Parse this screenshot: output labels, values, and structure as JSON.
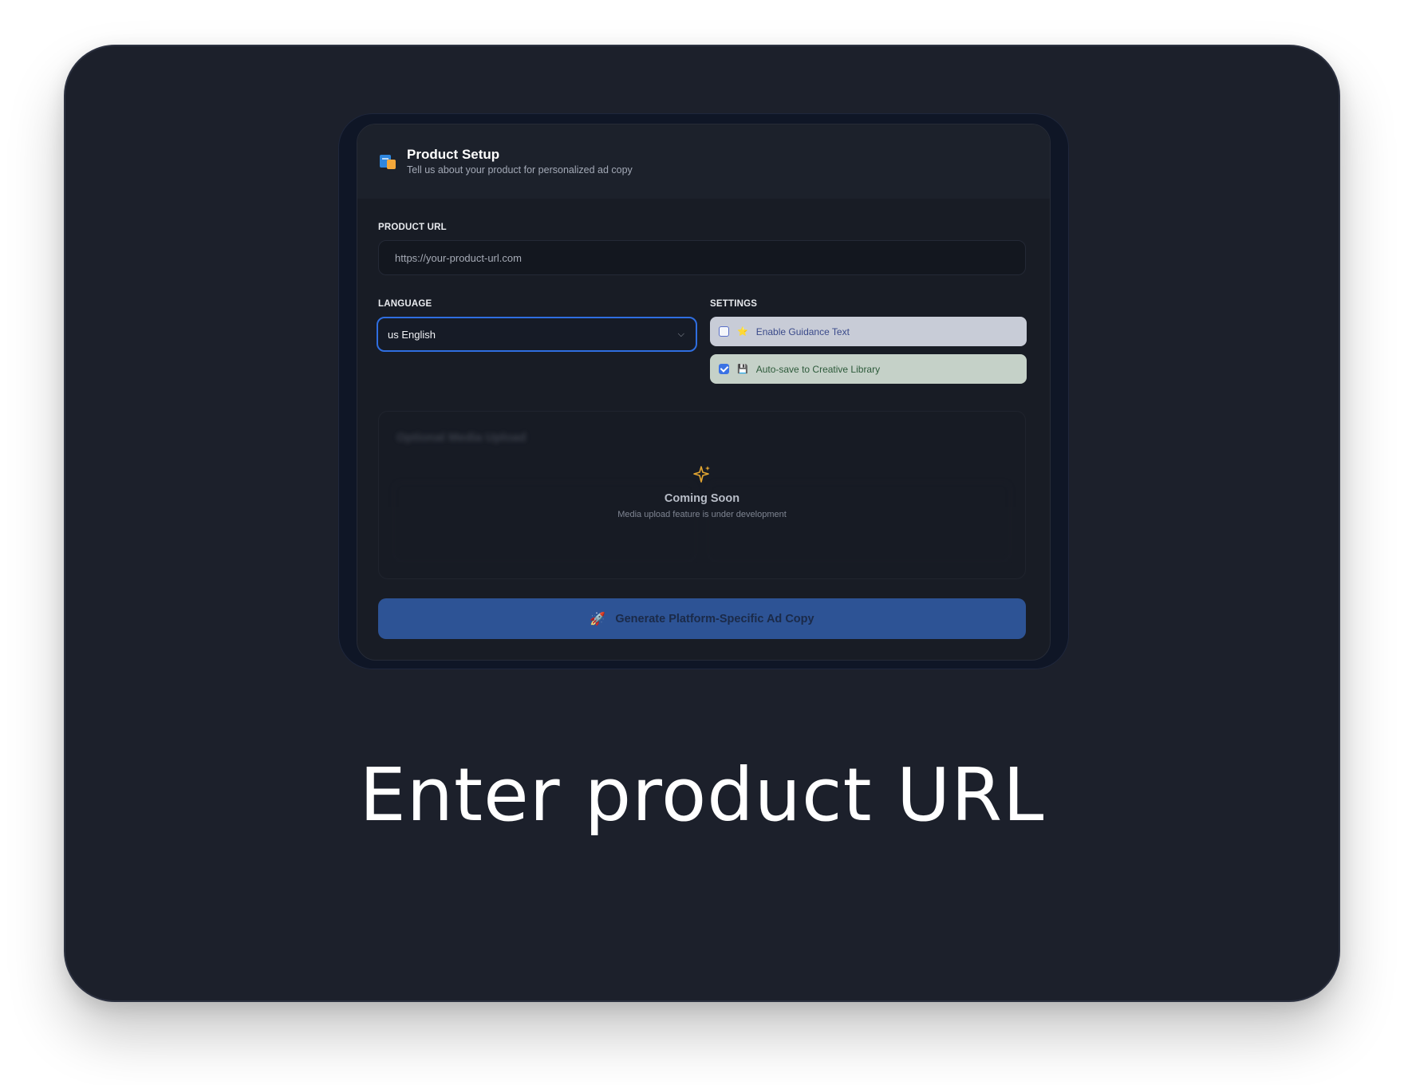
{
  "card": {
    "title": "Product Setup",
    "subtitle": "Tell us about your product for personalized ad copy"
  },
  "url_field": {
    "label": "PRODUCT URL",
    "placeholder": "https://your-product-url.com",
    "value": ""
  },
  "language": {
    "label": "LANGUAGE",
    "selected": "us English"
  },
  "settings": {
    "label": "SETTINGS",
    "guidance": {
      "emoji": "⭐",
      "label": "Enable Guidance Text",
      "checked": false
    },
    "autosave": {
      "emoji": "💾",
      "label": "Auto-save to Creative Library",
      "checked": true
    }
  },
  "media": {
    "ghost_title": "Optional Media Upload",
    "coming_title": "Coming Soon",
    "coming_sub": "Media upload feature is under development"
  },
  "generate": {
    "emoji": "🚀",
    "label": "Generate Platform-Specific Ad Copy"
  },
  "caption": "Enter product URL",
  "colors": {
    "slide_bg": "#1c202b",
    "accent": "#2f6ee0",
    "button": "#2d5395",
    "spark": "#e2a531"
  }
}
